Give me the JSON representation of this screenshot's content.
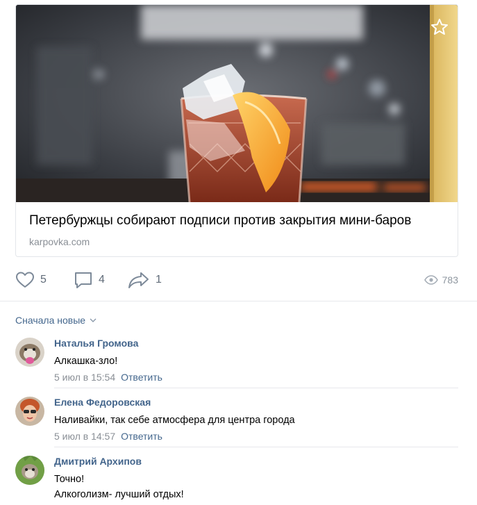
{
  "post": {
    "link_title": "Петербуржцы собирают подписи против закрытия мини-баров",
    "link_domain": "karpovka.com",
    "likes": "5",
    "comments": "4",
    "shares": "1",
    "views": "783"
  },
  "comments_section": {
    "sort_label": "Сначала новые",
    "reply_label": "Ответить",
    "items": [
      {
        "author": "Наталья Громова",
        "lines": [
          "Алкашка-зло!"
        ],
        "date": "5 июл в 15:54"
      },
      {
        "author": "Елена Федоровская",
        "lines": [
          "Наливайки, так себе атмосфера для центра города"
        ],
        "date": "5 июл в 14:57"
      },
      {
        "author": "Дмитрий Архипов",
        "lines": [
          "Точно!",
          "Алкоголизм- лучший отдых!"
        ]
      }
    ]
  },
  "colors": {
    "link": "#42648b",
    "muted": "#8a8f96",
    "action": "#616c79"
  },
  "icons": [
    "star-icon",
    "heart-icon",
    "comment-icon",
    "share-icon",
    "eye-icon",
    "chevron-down-icon"
  ]
}
